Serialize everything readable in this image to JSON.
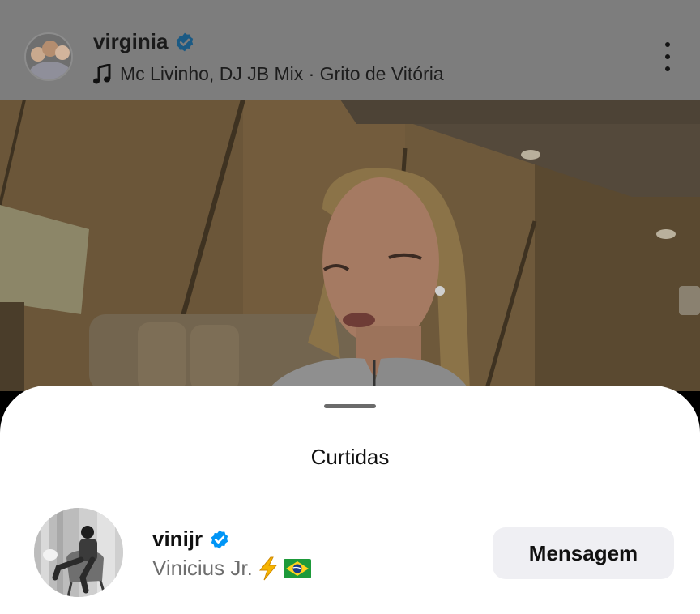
{
  "post_header": {
    "username": "virginia",
    "verified": true,
    "music": "Mc Livinho, DJ JB Mix · Grito de Vitória"
  },
  "likes_sheet": {
    "title": "Curtidas",
    "users": [
      {
        "username": "vinijr",
        "verified": true,
        "full_name": "Vinicius Jr.",
        "name_suffix_icons": [
          "lightning-bolt-icon",
          "brazil-flag-icon"
        ],
        "button_label": "Mensagem"
      }
    ]
  },
  "colors": {
    "verified_blue": "#0095f6",
    "button_bg": "#efeff3",
    "overlay_dim": "#7d7d7d"
  }
}
